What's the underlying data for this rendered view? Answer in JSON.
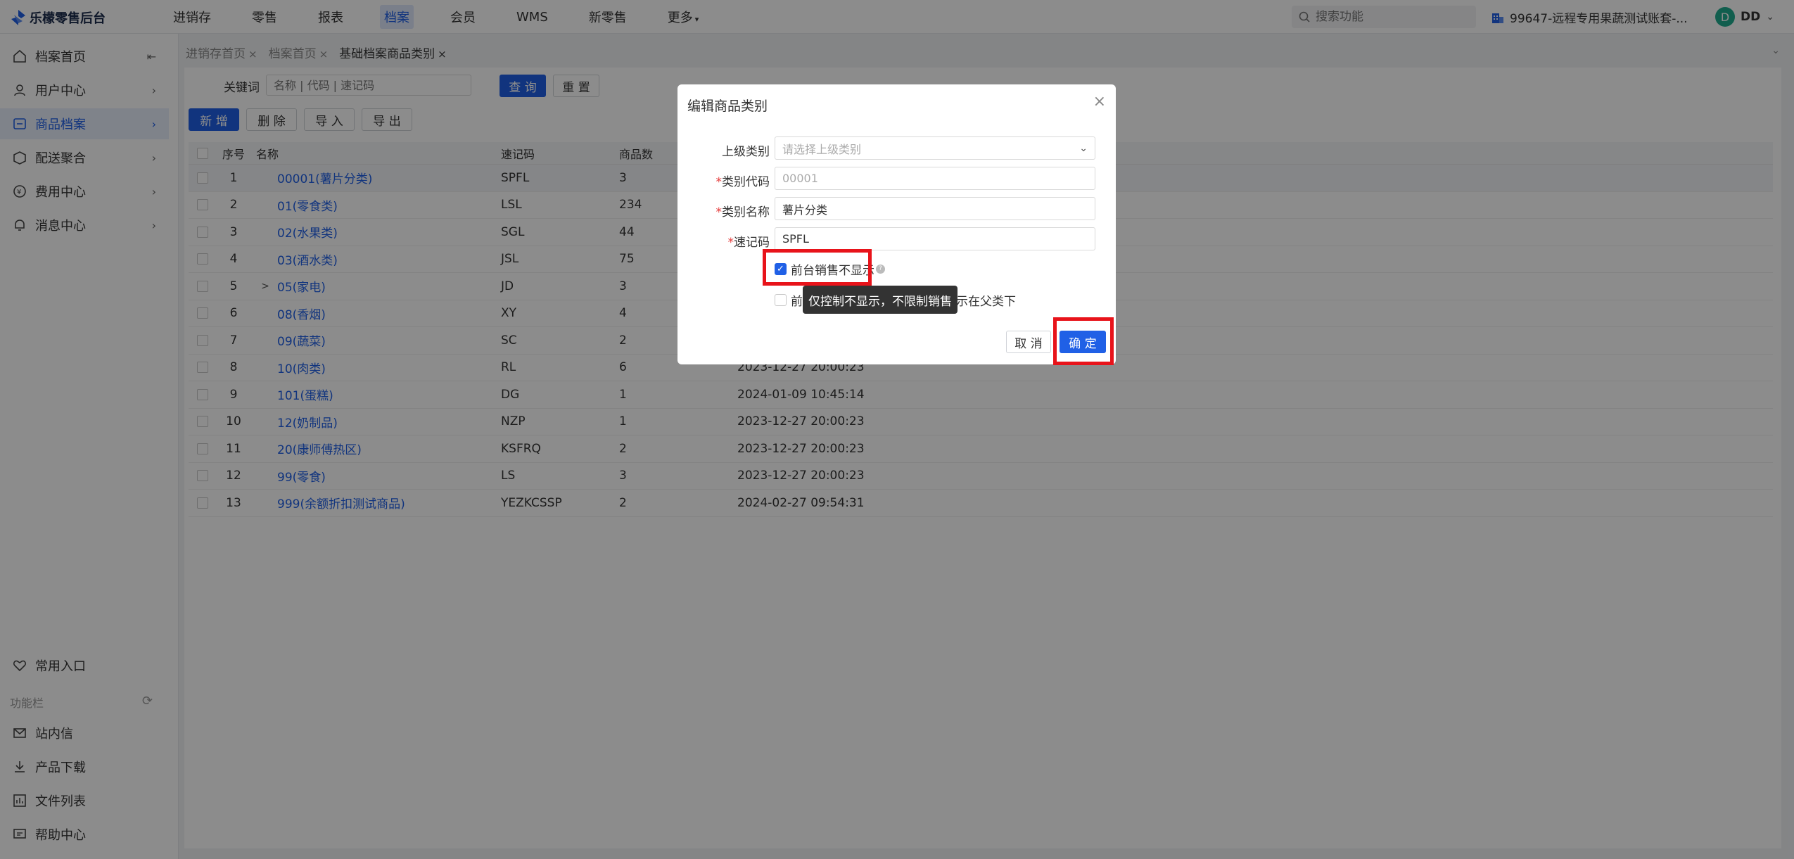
{
  "app": {
    "name": "乐檬零售后台"
  },
  "topnav": [
    "进销存",
    "零售",
    "报表",
    "档案",
    "会员",
    "WMS",
    "新零售",
    "更多"
  ],
  "search": {
    "placeholder": "搜索功能"
  },
  "account": {
    "name": "99647-远程专用果蔬测试账套-..."
  },
  "user": {
    "avatar": "D",
    "name": "DD"
  },
  "sidebar": {
    "items": [
      {
        "label": "档案首页"
      },
      {
        "label": "用户中心"
      },
      {
        "label": "商品档案"
      },
      {
        "label": "配送聚合"
      },
      {
        "label": "费用中心"
      },
      {
        "label": "消息中心"
      }
    ],
    "bottom": [
      {
        "label": "常用入口"
      },
      {
        "label": "站内信"
      },
      {
        "label": "产品下载"
      },
      {
        "label": "文件列表"
      },
      {
        "label": "帮助中心"
      }
    ],
    "section_label": "功能栏"
  },
  "tabs": [
    "进销存首页",
    "档案首页",
    "基础档案商品类别"
  ],
  "toolbar": {
    "keyword_label": "关键词",
    "keyword_placeholder": "名称 | 代码 | 速记码",
    "query": "查 询",
    "reset": "重 置",
    "add": "新 增",
    "delete": "删 除",
    "import": "导 入",
    "export": "导 出"
  },
  "table": {
    "columns": [
      "序号",
      "名称",
      "速记码",
      "商品数"
    ],
    "rows": [
      {
        "idx": "1",
        "expand": "",
        "name": "00001(薯片分类)",
        "code": "SPFL",
        "count": "3",
        "time": ""
      },
      {
        "idx": "2",
        "expand": "",
        "name": "01(零食类)",
        "code": "LSL",
        "count": "234",
        "time": ""
      },
      {
        "idx": "3",
        "expand": "",
        "name": "02(水果类)",
        "code": "SGL",
        "count": "44",
        "time": ""
      },
      {
        "idx": "4",
        "expand": "",
        "name": "03(酒水类)",
        "code": "JSL",
        "count": "75",
        "time": ""
      },
      {
        "idx": "5",
        "expand": ">",
        "name": "05(家电)",
        "code": "JD",
        "count": "3",
        "time": ""
      },
      {
        "idx": "6",
        "expand": "",
        "name": "08(香烟)",
        "code": "XY",
        "count": "4",
        "time": ""
      },
      {
        "idx": "7",
        "expand": "",
        "name": "09(蔬菜)",
        "code": "SC",
        "count": "2",
        "time": ""
      },
      {
        "idx": "8",
        "expand": "",
        "name": "10(肉类)",
        "code": "RL",
        "count": "6",
        "time": "2023-12-27 20:00:23"
      },
      {
        "idx": "9",
        "expand": "",
        "name": "101(蛋糕)",
        "code": "DG",
        "count": "1",
        "time": "2024-01-09 10:45:14"
      },
      {
        "idx": "10",
        "expand": "",
        "name": "12(奶制品)",
        "code": "NZP",
        "count": "1",
        "time": "2023-12-27 20:00:23"
      },
      {
        "idx": "11",
        "expand": "",
        "name": "20(康师傅热区)",
        "code": "KSFRQ",
        "count": "2",
        "time": "2023-12-27 20:00:23"
      },
      {
        "idx": "12",
        "expand": "",
        "name": "99(零食)",
        "code": "LS",
        "count": "3",
        "time": "2023-12-27 20:00:23"
      },
      {
        "idx": "13",
        "expand": "",
        "name": "999(余额折扣测试商品)",
        "code": "YEZKCSSP",
        "count": "2",
        "time": "2024-02-27 09:54:31"
      }
    ]
  },
  "dialog": {
    "title": "编辑商品类别",
    "fields": {
      "parent": {
        "label": "上级类别",
        "placeholder": "请选择上级类别"
      },
      "code": {
        "label": "类别代码",
        "value": "00001"
      },
      "name": {
        "label": "类别名称",
        "value": "薯片分类"
      },
      "shortcode": {
        "label": "速记码",
        "value": "SPFL"
      }
    },
    "checkbox1": {
      "label": "前台销售不显示",
      "checked": true
    },
    "checkbox2": {
      "label_prefix": "前",
      "label_suffix": "示在父类下",
      "checked": false
    },
    "tooltip": "仅控制不显示，不限制销售",
    "cancel": "取 消",
    "confirm": "确 定"
  },
  "colors": {
    "primary": "#2060e6",
    "highlight": "#e8131a",
    "required": "#e53b3b"
  }
}
